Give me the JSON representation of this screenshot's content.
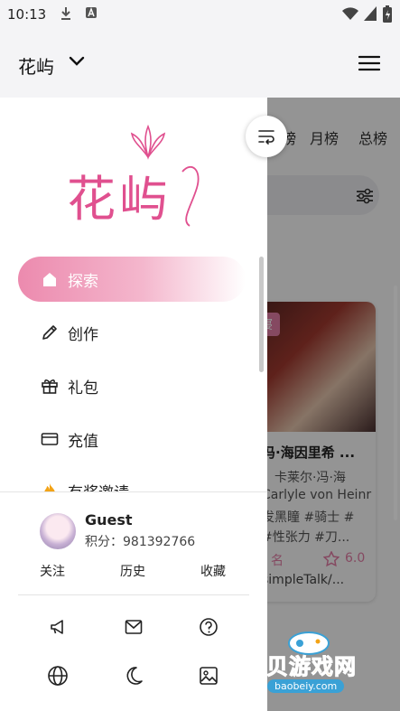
{
  "status_bar": {
    "time": "10:13"
  },
  "app_bar": {
    "title": "花屿"
  },
  "background": {
    "tabs": [
      "月榜",
      "总榜"
    ],
    "tab_partial": "榜",
    "card": {
      "tag": "寝",
      "title": "冯·海因里希 ...",
      "line1": "：卡莱尔·冯·海",
      "line2": "Carlyle von Heinr",
      "line3": "发黑瞳 #骑士 #",
      "line4": "#性张力 #刀...",
      "rank": "名",
      "score": "6.0",
      "author": "simpleTalk/..."
    }
  },
  "drawer": {
    "logo_text": "花屿",
    "nav": [
      {
        "label": "探索",
        "icon": "home-icon",
        "active": true
      },
      {
        "label": "创作",
        "icon": "pencil-icon",
        "active": false
      },
      {
        "label": "礼包",
        "icon": "gift-icon",
        "active": false
      },
      {
        "label": "充值",
        "icon": "card-icon",
        "active": false
      },
      {
        "label": "有奖邀请",
        "icon": "fire-icon",
        "active": false
      }
    ],
    "user": {
      "name": "Guest",
      "points": "积分：981392766"
    },
    "links": {
      "follow": "关注",
      "history": "历史",
      "favorites": "收藏"
    }
  },
  "watermark": {
    "text": "宝贝游戏网",
    "url": "baobeiy.com"
  },
  "colors": {
    "accent": "#e57fa8",
    "accent_dark": "#e0508f"
  }
}
